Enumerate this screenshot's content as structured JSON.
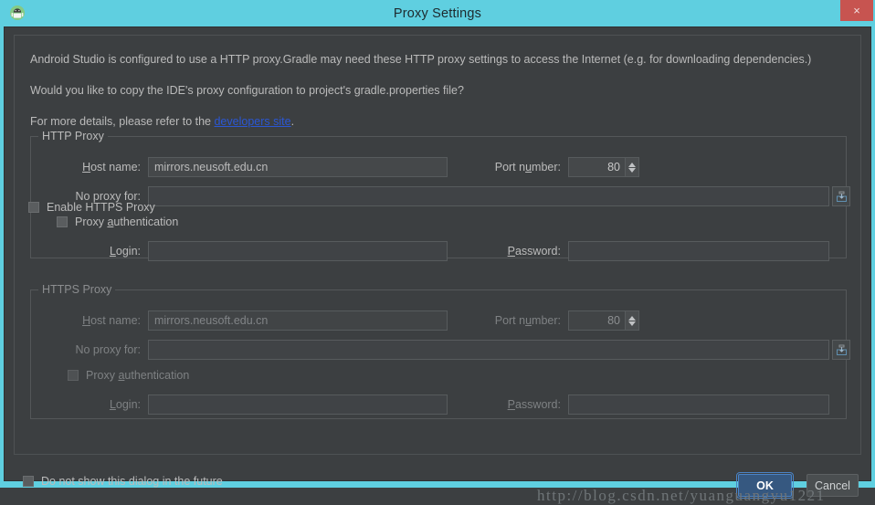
{
  "window": {
    "title": "Proxy Settings",
    "app_icon": "android-studio-icon",
    "close_label": "×",
    "titlebar_color": "#5fcfe0",
    "background_color": "#3c3f41",
    "accent_color": "#365880"
  },
  "message": {
    "line1": "Android Studio is configured to use a HTTP proxy.Gradle may need these HTTP proxy settings to access the Internet (e.g. for downloading dependencies.)",
    "line2": "Would you like to copy the IDE's proxy configuration to project's gradle.properties file?",
    "line3_prefix": "For more details, please refer to the ",
    "link_text": "developers site",
    "line3_suffix": ".",
    "link_color": "#2b57d4"
  },
  "http_proxy": {
    "group_title": "HTTP Proxy",
    "host_label": "Host name:",
    "host_value": "mirrors.neusoft.edu.cn",
    "port_label": "Port number:",
    "port_value": "80",
    "no_proxy_label": "No proxy for:",
    "no_proxy_value": "",
    "insert_icon": "insert-macro-icon",
    "auth_label": "Proxy authentication",
    "auth_checked": false,
    "login_label": "Login:",
    "login_value": "",
    "password_label": "Password:",
    "password_value": ""
  },
  "enable_https": {
    "label": "Enable HTTPS Proxy",
    "checked": false
  },
  "https_proxy": {
    "group_title": "HTTPS Proxy",
    "host_label": "Host name:",
    "host_value": "mirrors.neusoft.edu.cn",
    "port_label": "Port number:",
    "port_value": "80",
    "no_proxy_label": "No proxy for:",
    "no_proxy_value": "",
    "insert_icon": "insert-macro-icon",
    "auth_label": "Proxy authentication",
    "auth_checked": false,
    "login_label": "Login:",
    "login_value": "",
    "password_label": "Password:",
    "password_value": ""
  },
  "footer": {
    "do_not_show_label": "Do not show this dialog in the future",
    "do_not_show_checked": false,
    "ok_label": "OK",
    "cancel_label": "Cancel"
  },
  "watermark": {
    "text": "http://blog.csdn.net/yuanguangyu1221"
  }
}
